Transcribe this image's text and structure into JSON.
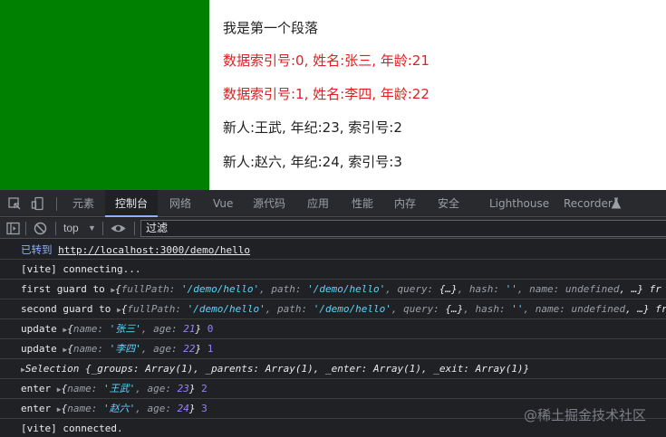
{
  "page": {
    "paragraphs": [
      {
        "text": "我是第一个段落",
        "color": "#222222"
      },
      {
        "text": "数据索引号:0, 姓名:张三, 年龄:21",
        "color": "#e02020"
      },
      {
        "text": "数据索引号:1, 姓名:李四, 年龄:22",
        "color": "#e02020"
      },
      {
        "text": "新人:王武, 年纪:23, 索引号:2",
        "color": "#222222"
      },
      {
        "text": "新人:赵六, 年纪:24, 索引号:3",
        "color": "#222222"
      }
    ],
    "box_color": "#008000"
  },
  "devtools": {
    "tabs": [
      "元素",
      "控制台",
      "网络",
      "Vue",
      "源代码",
      "应用",
      "性能",
      "内存",
      "安全",
      "Lighthouse",
      "Recorder"
    ],
    "active_tab": "控制台",
    "context": "top",
    "filter_placeholder": "过滤",
    "accent": "#8ab4f8"
  },
  "console": {
    "nav_prefix": "已转到",
    "nav_url": "http://localhost:3000/demo/hello",
    "connecting": "[vite] connecting...",
    "guard1_label": "first guard to",
    "guard2_label": "second guard to",
    "guard_obj": {
      "open": "{",
      "k1": "fullPath:",
      "v1": "'/demo/hello'",
      "k2": ", path:",
      "v2": "'/demo/hello'",
      "k3": ", query:",
      "v3": "{…}",
      "k4": ", hash:",
      "v4": "''",
      "k5": ", name:",
      "v5": "undefined",
      "tail": ", …}",
      "overflow": "fr"
    },
    "update_label": "update",
    "enter_label": "enter",
    "rows": [
      {
        "name": "'张三'",
        "age": "21",
        "index": "0"
      },
      {
        "name": "'李四'",
        "age": "22",
        "index": "1"
      },
      {
        "name": "'王武'",
        "age": "23",
        "index": "2"
      },
      {
        "name": "'赵六'",
        "age": "24",
        "index": "3"
      }
    ],
    "name_key": "name:",
    "age_key": ", age:",
    "selection": {
      "label": "Selection",
      "k1": "{_groups:",
      "v1": "Array(1)",
      "k2": ", _parents:",
      "v2": "Array(1)",
      "k3": ", _enter:",
      "v3": "Array(1)",
      "k4": ", _exit:",
      "v4": "Array(1)",
      "close": "}"
    },
    "connected": "[vite] connected."
  },
  "watermark": "@稀土掘金技术社区",
  "icons": [
    "inspect-icon",
    "device-toggle-icon",
    "sidebar-icon",
    "clear-console-icon",
    "eye-icon",
    "recorder-flask-icon"
  ]
}
